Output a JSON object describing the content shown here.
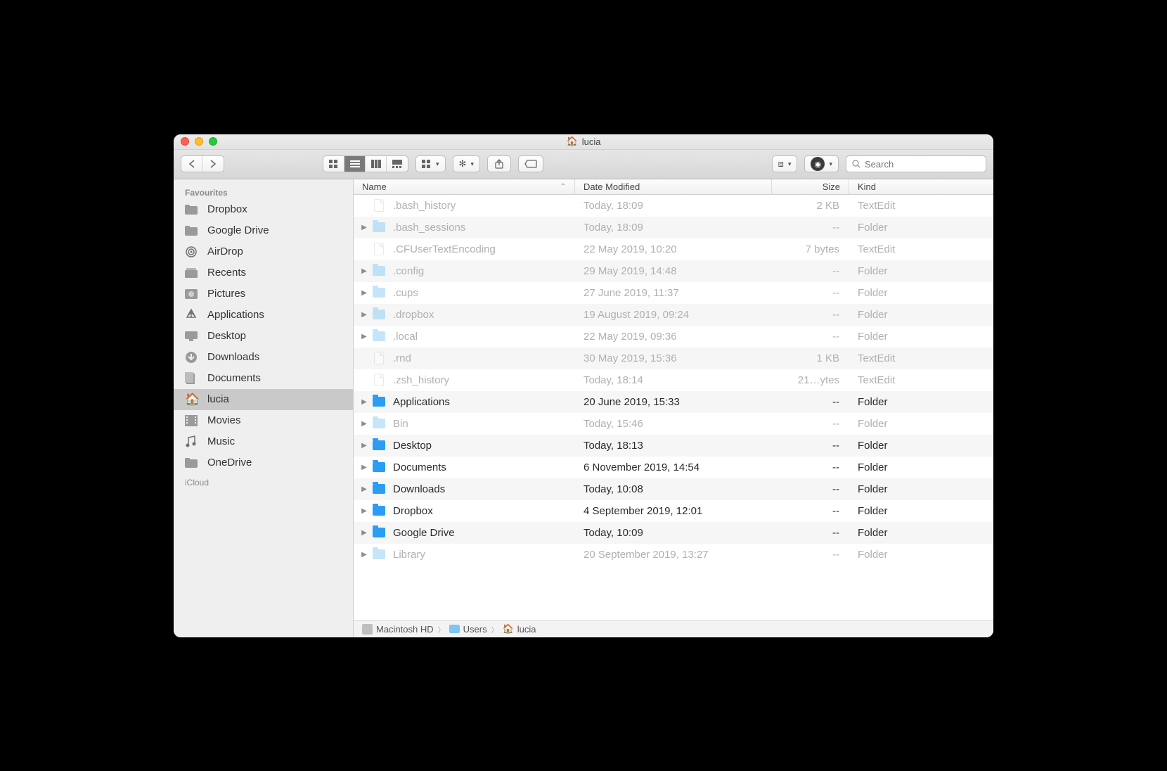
{
  "window_title": "lucia",
  "search_placeholder": "Search",
  "sidebar": {
    "section1": "Favourites",
    "section2": "iCloud",
    "items": [
      {
        "icon": "folder",
        "label": "Dropbox"
      },
      {
        "icon": "folder",
        "label": "Google Drive"
      },
      {
        "icon": "airdrop",
        "label": "AirDrop"
      },
      {
        "icon": "recents",
        "label": "Recents"
      },
      {
        "icon": "pictures",
        "label": "Pictures"
      },
      {
        "icon": "apps",
        "label": "Applications"
      },
      {
        "icon": "desktop",
        "label": "Desktop"
      },
      {
        "icon": "downloads",
        "label": "Downloads"
      },
      {
        "icon": "documents",
        "label": "Documents"
      },
      {
        "icon": "home",
        "label": "lucia"
      },
      {
        "icon": "movies",
        "label": "Movies"
      },
      {
        "icon": "music",
        "label": "Music"
      },
      {
        "icon": "folder",
        "label": "OneDrive"
      }
    ],
    "selected_index": 9
  },
  "columns": {
    "name": "Name",
    "date": "Date Modified",
    "size": "Size",
    "kind": "Kind"
  },
  "files": [
    {
      "expandable": false,
      "hidden": true,
      "type": "doc",
      "name": ".bash_history",
      "date": "Today, 18:09",
      "size": "2 KB",
      "kind": "TextEdit"
    },
    {
      "expandable": true,
      "hidden": true,
      "type": "fold",
      "name": ".bash_sessions",
      "date": "Today, 18:09",
      "size": "--",
      "kind": "Folder"
    },
    {
      "expandable": false,
      "hidden": true,
      "type": "doc",
      "name": ".CFUserTextEncoding",
      "date": "22 May 2019, 10:20",
      "size": "7 bytes",
      "kind": "TextEdit"
    },
    {
      "expandable": true,
      "hidden": true,
      "type": "fold",
      "name": ".config",
      "date": "29 May 2019, 14:48",
      "size": "--",
      "kind": "Folder"
    },
    {
      "expandable": true,
      "hidden": true,
      "type": "fold",
      "name": ".cups",
      "date": "27 June 2019, 11:37",
      "size": "--",
      "kind": "Folder"
    },
    {
      "expandable": true,
      "hidden": true,
      "type": "fold",
      "name": ".dropbox",
      "date": "19 August 2019, 09:24",
      "size": "--",
      "kind": "Folder"
    },
    {
      "expandable": true,
      "hidden": true,
      "type": "fold",
      "name": ".local",
      "date": "22 May 2019, 09:36",
      "size": "--",
      "kind": "Folder"
    },
    {
      "expandable": false,
      "hidden": true,
      "type": "doc",
      "name": ".rnd",
      "date": "30 May 2019, 15:36",
      "size": "1 KB",
      "kind": "TextEdit"
    },
    {
      "expandable": false,
      "hidden": true,
      "type": "doc",
      "name": ".zsh_history",
      "date": "Today, 18:14",
      "size": "21…ytes",
      "kind": "TextEdit"
    },
    {
      "expandable": true,
      "hidden": false,
      "type": "foldb",
      "name": "Applications",
      "date": "20 June 2019, 15:33",
      "size": "--",
      "kind": "Folder"
    },
    {
      "expandable": true,
      "hidden": true,
      "type": "fold",
      "name": "Bin",
      "date": "Today, 15:46",
      "size": "--",
      "kind": "Folder"
    },
    {
      "expandable": true,
      "hidden": false,
      "type": "foldb",
      "name": "Desktop",
      "date": "Today, 18:13",
      "size": "--",
      "kind": "Folder"
    },
    {
      "expandable": true,
      "hidden": false,
      "type": "foldb",
      "name": "Documents",
      "date": "6 November 2019, 14:54",
      "size": "--",
      "kind": "Folder"
    },
    {
      "expandable": true,
      "hidden": false,
      "type": "foldb",
      "name": "Downloads",
      "date": "Today, 10:08",
      "size": "--",
      "kind": "Folder"
    },
    {
      "expandable": true,
      "hidden": false,
      "type": "foldb",
      "name": "Dropbox",
      "date": "4 September 2019, 12:01",
      "size": "--",
      "kind": "Folder"
    },
    {
      "expandable": true,
      "hidden": false,
      "type": "foldb",
      "name": "Google Drive",
      "date": "Today, 10:09",
      "size": "--",
      "kind": "Folder"
    },
    {
      "expandable": true,
      "hidden": true,
      "type": "fold",
      "name": "Library",
      "date": "20 September 2019, 13:27",
      "size": "--",
      "kind": "Folder"
    }
  ],
  "pathbar": [
    {
      "icon": "hd",
      "label": "Macintosh HD"
    },
    {
      "icon": "users",
      "label": "Users"
    },
    {
      "icon": "home",
      "label": "lucia"
    }
  ]
}
